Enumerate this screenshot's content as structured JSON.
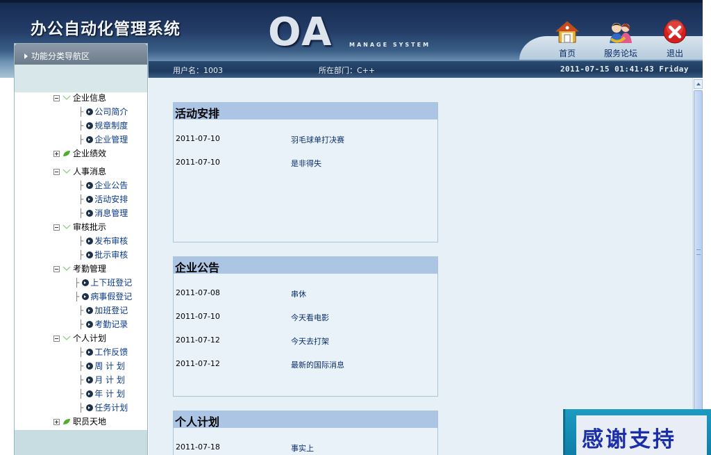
{
  "header": {
    "system_title": "办公自动化管理系统",
    "logo_text": "OA",
    "logo_subtitle": "MANAGE SYSTEM",
    "buttons": {
      "home": "首页",
      "forum": "服务论坛",
      "exit": "退出"
    },
    "user_label": "用户名：1003",
    "dept_label": "所在部门：C++",
    "datetime": "2011-07-15 01:41:43 Friday"
  },
  "sidebar": {
    "title": "功能分类导航区",
    "tree": [
      {
        "label": "企业信息",
        "expanded": true,
        "children": [
          "公司简介",
          "规章制度",
          "企业管理"
        ]
      },
      {
        "label": "企业绩效",
        "expanded": false,
        "children": []
      },
      {
        "label": "人事消息",
        "expanded": true,
        "children": [
          "企业公告",
          "活动安排",
          "消息管理"
        ]
      },
      {
        "label": "审核批示",
        "expanded": true,
        "children": [
          "发布审核",
          "批示审核"
        ]
      },
      {
        "label": "考勤管理",
        "expanded": true,
        "children": [
          "上下班登记",
          "病事假登记",
          "加班登记",
          "考勤记录"
        ]
      },
      {
        "label": "个人计划",
        "expanded": true,
        "children": [
          "工作反馈",
          "周 计 划",
          "月 计 划",
          "年 计 划",
          "任务计划"
        ]
      },
      {
        "label": "职员天地",
        "expanded": false,
        "children": []
      }
    ]
  },
  "main": {
    "panels": [
      {
        "title": "活动安排",
        "rows": [
          {
            "date": "2011-07-10",
            "text": "羽毛球单打决赛"
          },
          {
            "date": "2011-07-10",
            "text": "是非得失"
          }
        ]
      },
      {
        "title": "企业公告",
        "rows": [
          {
            "date": "2011-07-08",
            "text": "串休"
          },
          {
            "date": "2011-07-10",
            "text": "今天看电影"
          },
          {
            "date": "2011-07-12",
            "text": "今天去打架"
          },
          {
            "date": "2011-07-12",
            "text": "最新的国际消息"
          }
        ]
      },
      {
        "title": "个人计划",
        "rows": [
          {
            "date": "2011-07-18",
            "text": "事实上"
          }
        ]
      }
    ]
  },
  "banner": {
    "text": "感谢支持"
  },
  "colors": {
    "header_dark": "#1e3a5e",
    "panel_title_bg": "#adc5e4",
    "main_bg": "#e6f0f6",
    "link": "#0a2d6a",
    "banner_text": "#1b2fa8"
  },
  "icons": {
    "home": "house-icon",
    "forum": "people-icon",
    "exit": "close-icon"
  }
}
